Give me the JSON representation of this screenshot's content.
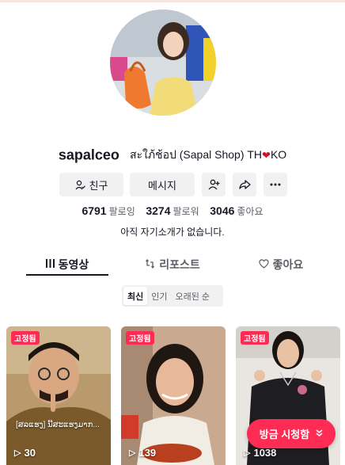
{
  "profile": {
    "username": "sapalceo",
    "nickname": "สะใภ้ช้อป (Sapal Shop) TH",
    "nickname_suffix": "KO",
    "heart_icon": "heart-icon",
    "bio": "아직 자기소개가 없습니다."
  },
  "actions": {
    "friends_label": "친구",
    "message_label": "메시지",
    "friends_icon": "person-check-icon",
    "add_icon": "person-plus-icon",
    "share_icon": "share-arrow-icon",
    "more_icon": "more-dots-icon"
  },
  "stats": {
    "following_count": "6791",
    "following_label": "팔로잉",
    "followers_count": "3274",
    "followers_label": "팔로워",
    "likes_count": "3046",
    "likes_label": "좋아요"
  },
  "tabs": [
    {
      "label": "동영상",
      "icon": "grid-icon",
      "active": true
    },
    {
      "label": "리포스트",
      "icon": "repost-icon",
      "active": false
    },
    {
      "label": "좋아요",
      "icon": "heart-outline-icon",
      "active": false
    }
  ],
  "sort": {
    "options": [
      "최신",
      "인기",
      "오래된 순"
    ],
    "selected": "최신"
  },
  "videos": [
    {
      "badge": "고정됨",
      "views": "30",
      "caption": "[ສລແຮງ] ນີ້ສະແຮງມາກ..."
    },
    {
      "badge": "고정됨",
      "views": "139"
    },
    {
      "badge": "고정됨",
      "views": "1038"
    }
  ],
  "watch_now": {
    "label": "방금 시청함",
    "icon": "chevron-down-double-icon"
  },
  "colors": {
    "accent": "#fe2c55",
    "text_primary": "#161823",
    "text_secondary": "#5c5e66",
    "button_bg": "#f1f1f2"
  }
}
